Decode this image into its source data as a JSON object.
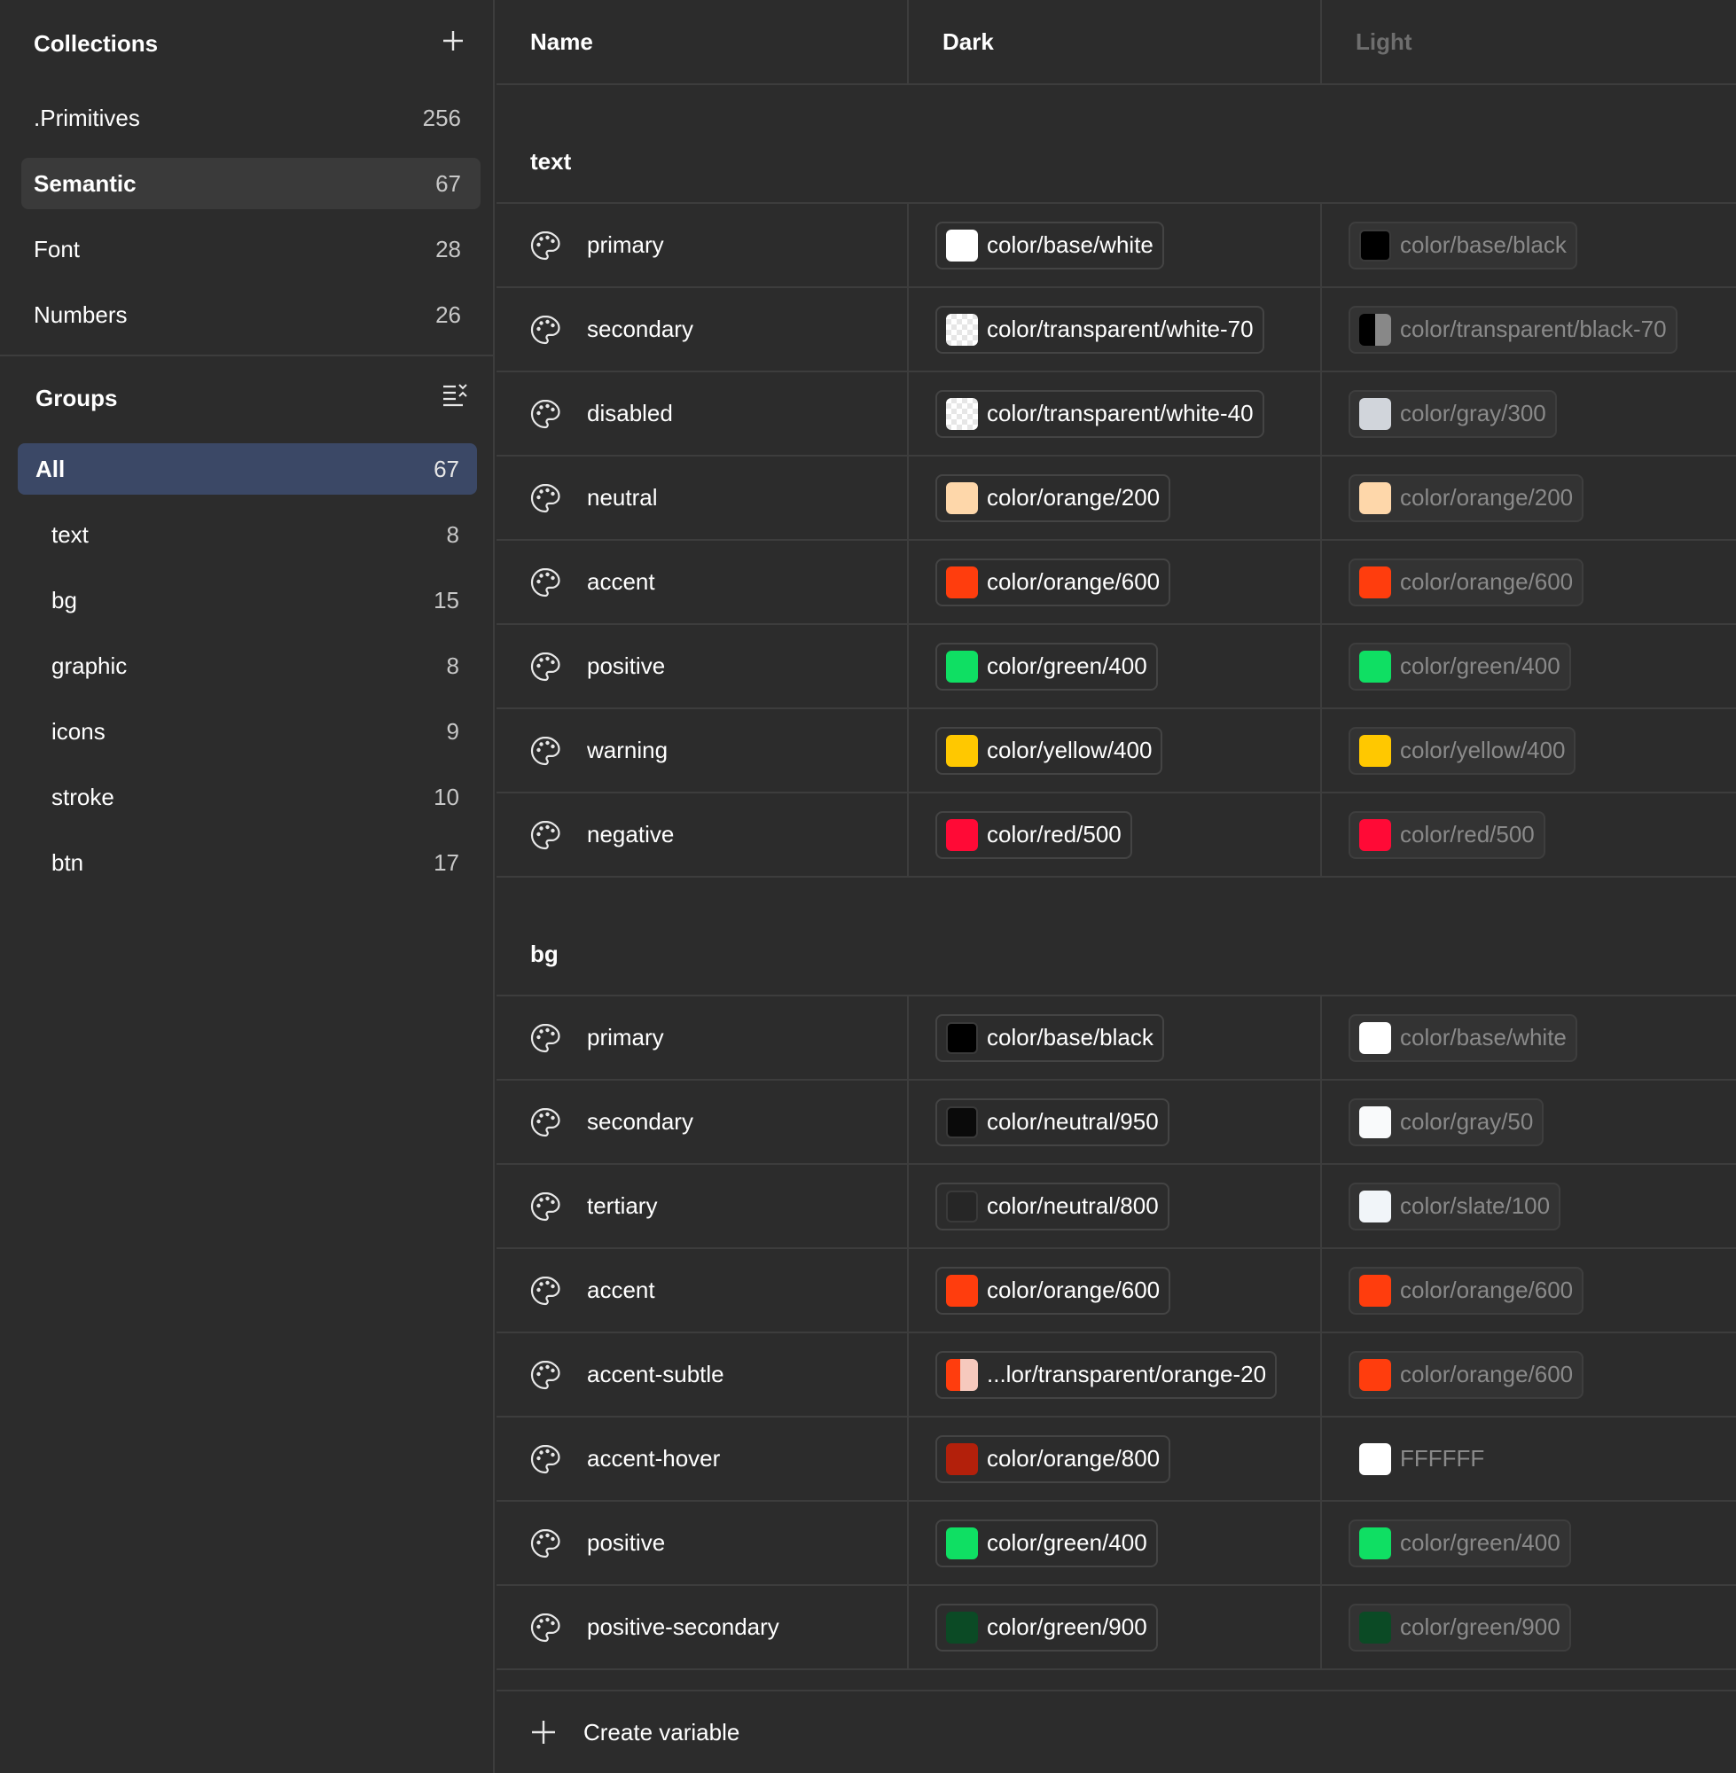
{
  "sidebar": {
    "collections_title": "Collections",
    "collections": [
      {
        "label": ".Primitives",
        "count": "256"
      },
      {
        "label": "Semantic",
        "count": "67",
        "selected": true
      },
      {
        "label": "Font",
        "count": "28"
      },
      {
        "label": "Numbers",
        "count": "26"
      }
    ],
    "groups_title": "Groups",
    "groups": [
      {
        "label": "All",
        "count": "67",
        "active": true
      },
      {
        "label": "text",
        "count": "8"
      },
      {
        "label": "bg",
        "count": "15"
      },
      {
        "label": "graphic",
        "count": "8"
      },
      {
        "label": "icons",
        "count": "9"
      },
      {
        "label": "stroke",
        "count": "10"
      },
      {
        "label": "btn",
        "count": "17"
      }
    ]
  },
  "table": {
    "headers": {
      "name": "Name",
      "dark": "Dark",
      "light": "Light"
    },
    "sections": [
      {
        "title": "text",
        "rows": [
          {
            "name": "primary",
            "dark": {
              "label": "color/base/white",
              "swatch": "#ffffff"
            },
            "light": {
              "label": "color/base/black",
              "swatch": "#000000"
            }
          },
          {
            "name": "secondary",
            "dark": {
              "label": "color/transparent/white-70",
              "swatch": "checker-white"
            },
            "light": {
              "label": "color/transparent/black-70",
              "swatch": "half-black"
            }
          },
          {
            "name": "disabled",
            "dark": {
              "label": "color/transparent/white-40",
              "swatch": "checker-white"
            },
            "light": {
              "label": "color/gray/300",
              "swatch": "#d1d5db"
            }
          },
          {
            "name": "neutral",
            "dark": {
              "label": "color/orange/200",
              "swatch": "#fed7aa"
            },
            "light": {
              "label": "color/orange/200",
              "swatch": "#fed7aa"
            }
          },
          {
            "name": "accent",
            "dark": {
              "label": "color/orange/600",
              "swatch": "#ff3d0d"
            },
            "light": {
              "label": "color/orange/600",
              "swatch": "#ff3d0d"
            }
          },
          {
            "name": "positive",
            "dark": {
              "label": "color/green/400",
              "swatch": "#0fdf63"
            },
            "light": {
              "label": "color/green/400",
              "swatch": "#0fdf63"
            }
          },
          {
            "name": "warning",
            "dark": {
              "label": "color/yellow/400",
              "swatch": "#ffc800"
            },
            "light": {
              "label": "color/yellow/400",
              "swatch": "#ffc800"
            }
          },
          {
            "name": "negative",
            "dark": {
              "label": "color/red/500",
              "swatch": "#ff0a36"
            },
            "light": {
              "label": "color/red/500",
              "swatch": "#ff0a36"
            }
          }
        ]
      },
      {
        "title": "bg",
        "rows": [
          {
            "name": "primary",
            "dark": {
              "label": "color/base/black",
              "swatch": "#000000"
            },
            "light": {
              "label": "color/base/white",
              "swatch": "#ffffff"
            }
          },
          {
            "name": "secondary",
            "dark": {
              "label": "color/neutral/950",
              "swatch": "#0a0a0a"
            },
            "light": {
              "label": "color/gray/50",
              "swatch": "#f9fafb"
            }
          },
          {
            "name": "tertiary",
            "dark": {
              "label": "color/neutral/800",
              "swatch": "#262626"
            },
            "light": {
              "label": "color/slate/100",
              "swatch": "#f1f5f9"
            }
          },
          {
            "name": "accent",
            "dark": {
              "label": "color/orange/600",
              "swatch": "#ff3d0d"
            },
            "light": {
              "label": "color/orange/600",
              "swatch": "#ff3d0d"
            }
          },
          {
            "name": "accent-subtle",
            "dark": {
              "label": "...lor/transparent/orange-20",
              "swatch": "half-orange"
            },
            "light": {
              "label": "color/orange/600",
              "swatch": "#ff3d0d"
            }
          },
          {
            "name": "accent-hover",
            "dark": {
              "label": "color/orange/800",
              "swatch": "#b3200b"
            },
            "light": {
              "label": "FFFFFF",
              "swatch": "#ffffff",
              "plain": true
            }
          },
          {
            "name": "positive",
            "dark": {
              "label": "color/green/400",
              "swatch": "#0fdf63"
            },
            "light": {
              "label": "color/green/400",
              "swatch": "#0fdf63"
            }
          },
          {
            "name": "positive-secondary",
            "dark": {
              "label": "color/green/900",
              "swatch": "#0b4a25"
            },
            "light": {
              "label": "color/green/900",
              "swatch": "#0b4a25"
            }
          }
        ]
      }
    ]
  },
  "footer": {
    "create_label": "Create variable"
  }
}
